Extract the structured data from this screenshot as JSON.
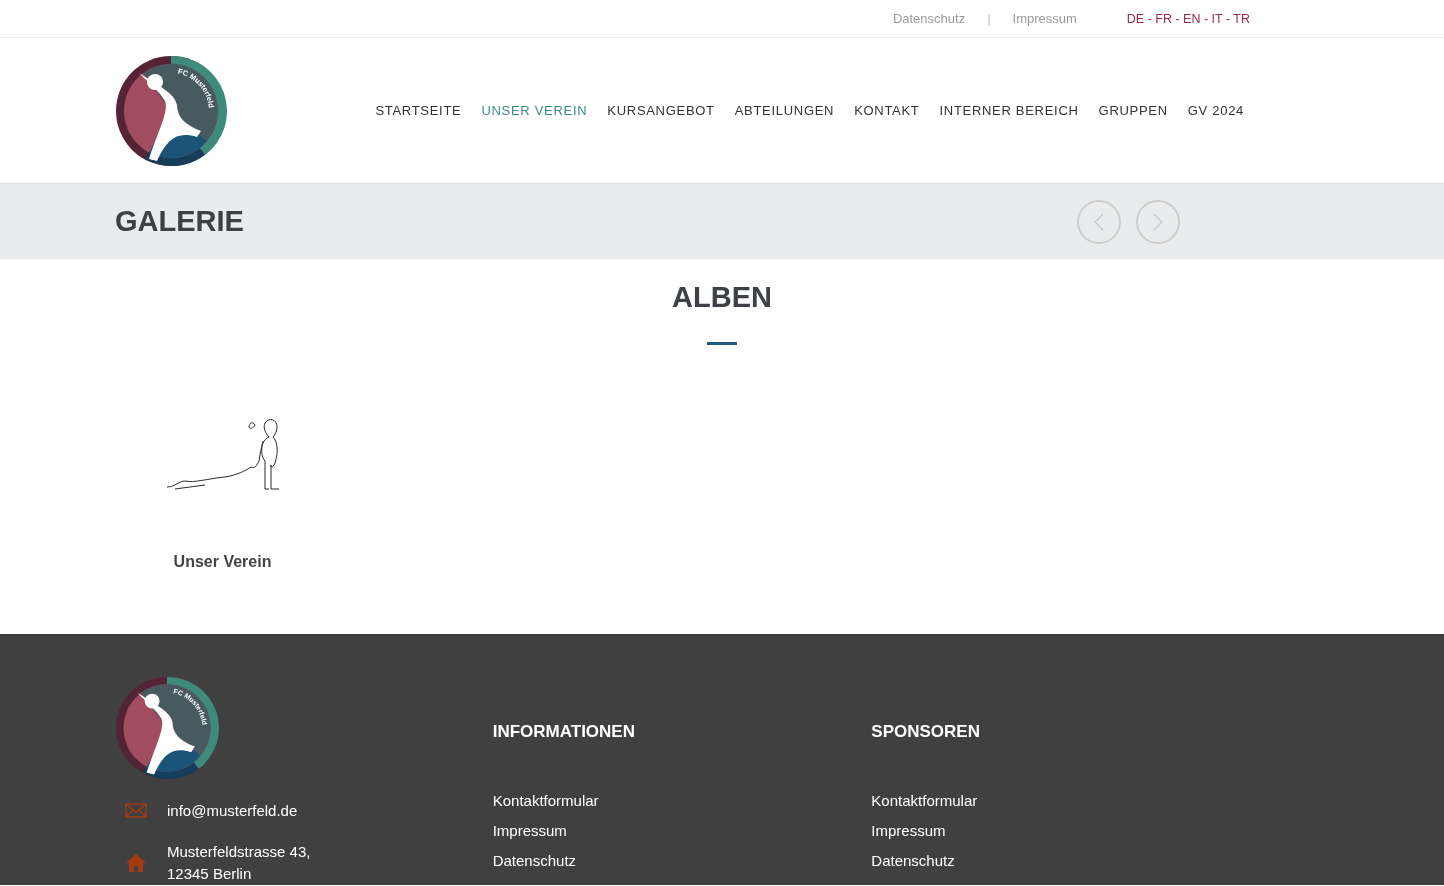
{
  "topbar": {
    "links": [
      "Datenschutz",
      "Impressum"
    ],
    "separator": "|",
    "languages": "DE - FR - EN - IT - TR"
  },
  "header": {
    "logo_text": "FC Musterfeld",
    "nav": [
      {
        "label": "STARTSEITE",
        "selected": false
      },
      {
        "label": "UNSER VEREIN",
        "selected": true
      },
      {
        "label": "KURSANGEBOT",
        "selected": false
      },
      {
        "label": "ABTEILUNGEN",
        "selected": false
      },
      {
        "label": "KONTAKT",
        "selected": false
      },
      {
        "label": "INTERNER BEREICH",
        "selected": false
      },
      {
        "label": "GRUPPEN",
        "selected": false
      },
      {
        "label": "GV 2024",
        "selected": false
      }
    ]
  },
  "page_title": "GALERIE",
  "section": {
    "heading": "ALBEN",
    "albums": [
      {
        "title": "Unser Verein"
      }
    ]
  },
  "footer": {
    "logo_text": "FC Musterfeld",
    "email": "info@musterfeld.de",
    "address": [
      "Musterfeldstrasse 43,",
      "12345 Berlin"
    ],
    "columns": [
      {
        "heading": "INFORMATIONEN",
        "links": [
          "Kontaktformular",
          "Impressum",
          "Datenschutz"
        ]
      },
      {
        "heading": "SPONSOREN",
        "links": [
          "Kontaktformular",
          "Impressum",
          "Datenschutz"
        ]
      }
    ]
  }
}
